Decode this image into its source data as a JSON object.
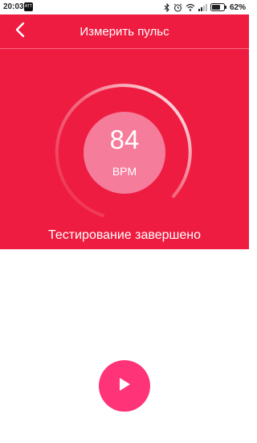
{
  "status_bar": {
    "time": "20:03",
    "app_badge": "ATT",
    "battery": "62%"
  },
  "header": {
    "title": "Измерить пульс",
    "back_icon": "chevron-left-icon"
  },
  "measurement": {
    "bpm": "84",
    "unit": "BPM",
    "status": "Тестирование завершено"
  },
  "controls": {
    "play_icon": "play-icon"
  },
  "colors": {
    "header_bg": "#ee1c40",
    "pulse_circle": "#f57c9b",
    "play_button": "#ff3377"
  }
}
